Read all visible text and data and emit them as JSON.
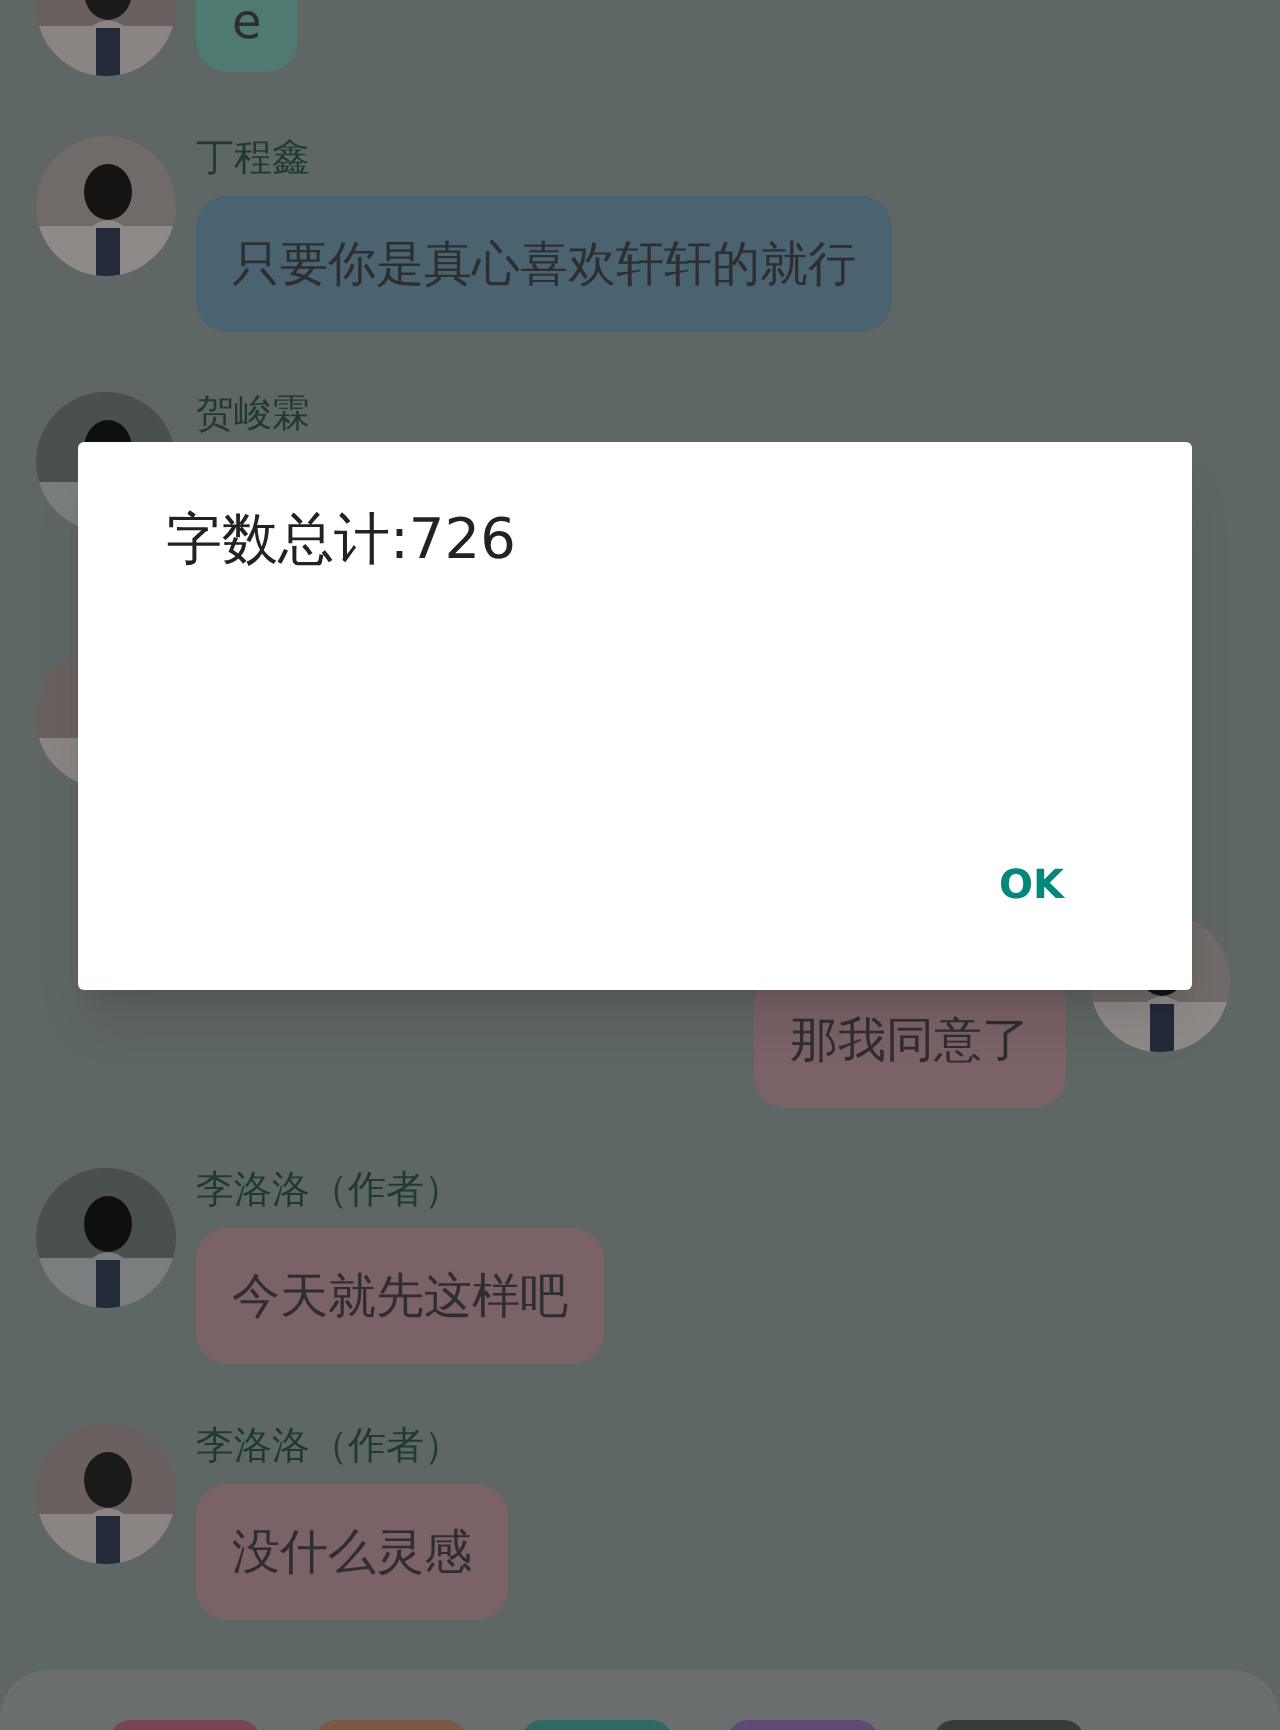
{
  "messages": [
    {
      "kind": "incoming",
      "text": "e",
      "color": "#4f7a72"
    },
    {
      "kind": "incoming",
      "name": "丁程鑫",
      "text": "只要你是真心喜欢轩轩的就行",
      "color": "#4a6370"
    },
    {
      "kind": "incoming",
      "name": "贺峻霖"
    },
    {
      "kind": "incoming"
    },
    {
      "kind": "outgoing",
      "text": "那我同意了",
      "color": "#7a6266"
    },
    {
      "kind": "incoming",
      "name": "李洛洛（作者）",
      "text": "今天就先这样吧",
      "color": "#7a6266"
    },
    {
      "kind": "incoming",
      "name": "李洛洛（作者）",
      "text": "没什么灵感",
      "color": "#7a6266"
    }
  ],
  "toolbar": {
    "chips": [
      {
        "color": "#7a4458"
      },
      {
        "color": "#7a5a44"
      },
      {
        "color": "#2f6a62"
      },
      {
        "color": "#5e4a74"
      },
      {
        "color": "#3a3a3a"
      }
    ]
  },
  "dialog": {
    "message": "字数总计:726",
    "button": "OK"
  }
}
